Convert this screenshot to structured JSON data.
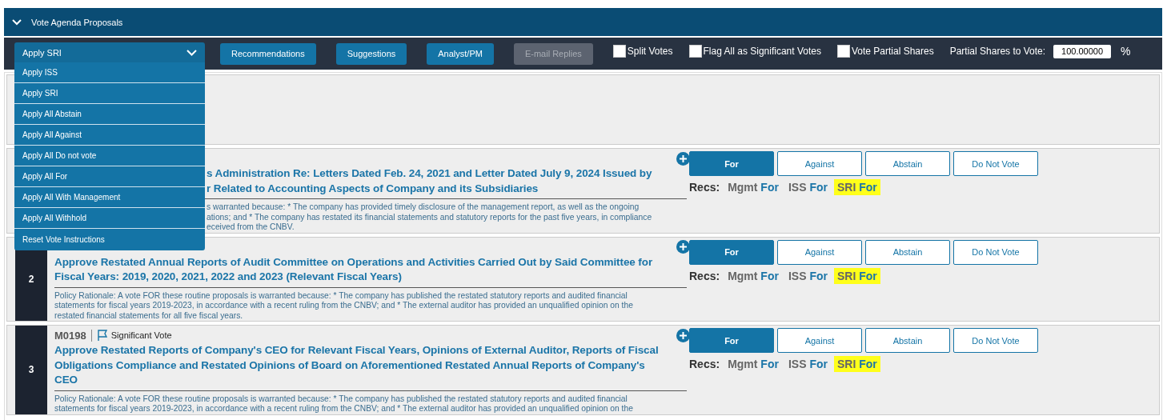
{
  "section": {
    "title": "Vote Agenda Proposals",
    "expanded": true
  },
  "toolbar": {
    "apply_select": {
      "value": "Apply SRI",
      "open": true,
      "options": [
        "Apply ISS",
        "Apply SRI",
        "Apply All Abstain",
        "Apply All Against",
        "Apply All Do not vote",
        "Apply All For",
        "Apply All With Management",
        "Apply All Withhold",
        "Reset Vote Instructions"
      ]
    },
    "buttons": [
      {
        "label": "Recommendations",
        "disabled": false
      },
      {
        "label": "Suggestions",
        "disabled": false
      },
      {
        "label": "Analyst/PM",
        "disabled": false
      },
      {
        "label": "E-mail Replies",
        "disabled": true
      }
    ],
    "checkboxes": [
      {
        "label": "Split Votes",
        "checked": false
      },
      {
        "label": "Flag All as Significant Votes",
        "checked": false
      },
      {
        "label": "Vote Partial Shares",
        "checked": false
      }
    ],
    "partial_shares": {
      "label": "Partial Shares to Vote:",
      "value": "100.00000",
      "unit": "%"
    }
  },
  "proposals": [
    {
      "covered_by_menu": true,
      "title_lines": [
        "s Administration Re: Letters Dated Feb. 24, 2021 and Letter Dated July 9, 2024 Issued by",
        "r Related to Accounting Aspects of Company and its Subsidiaries"
      ],
      "rationale_lines": [
        "s warranted because: * The company has provided timely disclosure of the management report, as well as the ongoing",
        "ations; and * The company has restated its financial statements and statutory reports for the past five years, in compliance",
        "eceived from the CNBV."
      ],
      "votes": [
        {
          "label": "For",
          "selected": true
        },
        {
          "label": "Against",
          "selected": false
        },
        {
          "label": "Abstain",
          "selected": false
        },
        {
          "label": "Do Not Vote",
          "selected": false
        }
      ],
      "recs_label": "Recs:",
      "recs": [
        {
          "source": "Mgmt",
          "vote": "For",
          "highlighted": false
        },
        {
          "source": "ISS",
          "vote": "For",
          "highlighted": false
        },
        {
          "source": "SRI",
          "vote": "For",
          "highlighted": true
        }
      ]
    },
    {
      "covered_by_menu": false,
      "number": "2",
      "title_lines": [
        "Approve Restated Annual Reports of Audit Committee on Operations and Activities Carried Out by Said Committee for",
        "Fiscal Years: 2019, 2020, 2021, 2022 and 2023 (Relevant Fiscal Years)"
      ],
      "rationale_lines": [
        "Policy Rationale: A vote FOR these routine proposals is warranted because: * The company has published the restated statutory reports and audited financial",
        "statements for fiscal years 2019-2023, in accordance with a recent ruling from the CNBV; and * The external auditor has provided an unqualified opinion on the",
        "restated financial statements for all five fiscal years."
      ],
      "votes": [
        {
          "label": "For",
          "selected": true
        },
        {
          "label": "Against",
          "selected": false
        },
        {
          "label": "Abstain",
          "selected": false
        },
        {
          "label": "Do Not Vote",
          "selected": false
        }
      ],
      "recs_label": "Recs:",
      "recs": [
        {
          "source": "Mgmt",
          "vote": "For",
          "highlighted": false
        },
        {
          "source": "ISS",
          "vote": "For",
          "highlighted": false
        },
        {
          "source": "SRI",
          "vote": "For",
          "highlighted": true
        }
      ]
    },
    {
      "covered_by_menu": false,
      "number": "3",
      "code": "M0198",
      "flag": "Significant Vote",
      "title_lines": [
        "Approve Restated Reports of Company's CEO for Relevant Fiscal Years, Opinions of External Auditor, Reports of Fiscal",
        "Obligations Compliance and Restated Opinions of Board on Aforementioned Restated Annual Reports of Company's",
        "CEO"
      ],
      "rationale_lines": [
        "Policy Rationale: A vote FOR these routine proposals is warranted because: * The company has published the restated statutory reports and audited financial",
        "statements for fiscal years 2019-2023, in accordance with a recent ruling from the CNBV; and * The external auditor has provided an unqualified opinion on the"
      ],
      "votes": [
        {
          "label": "For",
          "selected": true
        },
        {
          "label": "Against",
          "selected": false
        },
        {
          "label": "Abstain",
          "selected": false
        },
        {
          "label": "Do Not Vote",
          "selected": false
        }
      ],
      "recs_label": "Recs:",
      "recs": [
        {
          "source": "Mgmt",
          "vote": "For",
          "highlighted": false
        },
        {
          "source": "ISS",
          "vote": "For",
          "highlighted": false
        },
        {
          "source": "SRI",
          "vote": "For",
          "highlighted": true
        }
      ]
    }
  ]
}
